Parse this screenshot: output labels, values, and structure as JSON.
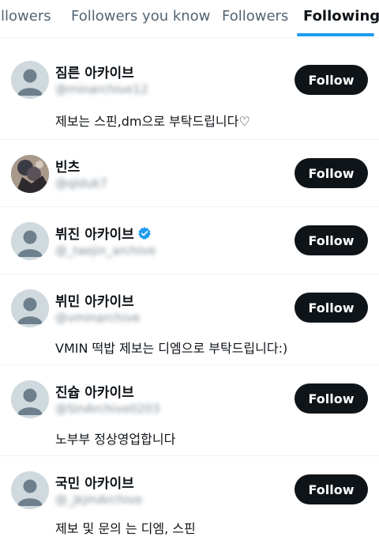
{
  "tabs": [
    {
      "label": "ollowers"
    },
    {
      "label": "Followers you know"
    },
    {
      "label": "Followers"
    },
    {
      "label": "Following"
    }
  ],
  "accent_color": "#1d9bf0",
  "users": [
    {
      "name": "짐른 아카이브",
      "handle": "@minarchive12",
      "bio": "제보는 스핀,dm으로 부탁드립니다♡",
      "button": "Follow",
      "verified": false
    },
    {
      "name": "빈츠",
      "handle": "@qlduk7",
      "bio": "",
      "button": "Follow",
      "verified": false
    },
    {
      "name": "뷔진 아카이브",
      "handle": "@_taejin_archive",
      "bio": "",
      "button": "Follow",
      "verified": true
    },
    {
      "name": "뷔민 아카이브",
      "handle": "@vminarchive",
      "bio": "VMIN 떡밥 제보는 디엠으로 부탁드립니다:)",
      "button": "Follow",
      "verified": false
    },
    {
      "name": "진슙 아카이브",
      "handle": "@SinArchive0203",
      "bio": "노부부 정상영업합니다",
      "button": "Follow",
      "verified": false
    },
    {
      "name": "국민 아카이브",
      "handle": "@_jkjmArchive",
      "bio": "제보 및 문의 는 디엠, 스핀",
      "button": "Follow",
      "verified": false
    }
  ]
}
